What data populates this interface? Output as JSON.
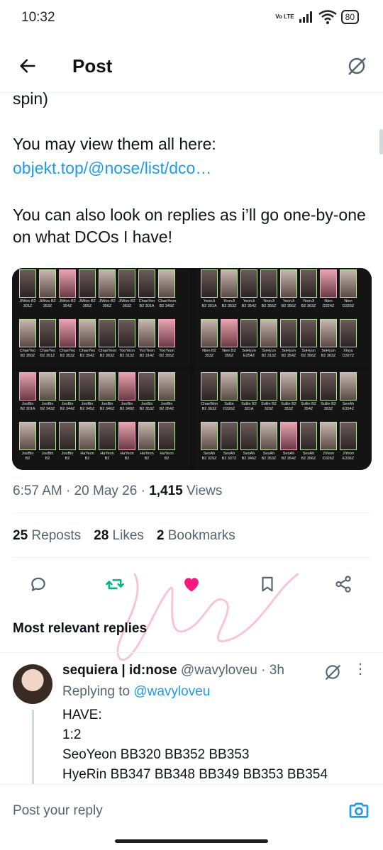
{
  "status_bar": {
    "time": "10:32",
    "network": "Vo LTE",
    "battery": "80"
  },
  "header": {
    "title": "Post"
  },
  "post": {
    "partial_text": "spin)",
    "view_text": "You may view them all here:",
    "link_text": "objekt.top/@nose/list/dco…",
    "replies_text": "You can also look on replies as i’ll go one-by-one on what DCOs I have!",
    "media_grid": [
      {
        "names": [
          "JiWoo",
          "JiWoo",
          "JiWoo",
          "JiWoo",
          "JiWoo",
          "JiWoo",
          "ChaeYeo",
          "ChaeYeon"
        ],
        "codes": [
          "B2 301Z",
          "B2 353Z",
          "B2 354Z",
          "B2 355Z",
          "B2 356Z",
          "B2 363Z",
          "B2 301A",
          "B2 349Z"
        ]
      },
      {
        "names": [
          "ChaeYeo",
          "ChaeYeo",
          "ChaeYeo",
          "ChaeYeo",
          "ChaeYeon",
          "YooYeon",
          "YooYeon",
          "YooYeon"
        ],
        "codes": [
          "B2 350Z",
          "B2 351Z",
          "B2 353Z",
          "B2 354Z",
          "B2 363Z",
          "B2 313Z",
          "B2 314Z",
          "B2 355Z"
        ]
      },
      {
        "names": [
          "YeonJi",
          "YeonJi",
          "YeonJi",
          "YeonJi",
          "YeonJi",
          "YeonJi",
          "Nien",
          "Nien"
        ],
        "codes": [
          "B2 301A",
          "B2 353Z",
          "B2 354Z",
          "B2 355Z",
          "B2 356Z",
          "B2 363Z",
          "D324Z",
          "D325Z"
        ]
      },
      {
        "names": [
          "Nien",
          "Nien",
          "SoHyun",
          "SoHyun",
          "SoHyun",
          "SoHyun",
          "SoHyun",
          "Xinyu"
        ],
        "codes": [
          "B2 353Z",
          "B2 356Z",
          "E354Z",
          "B2 313Z",
          "B2 354Z",
          "B2 356Z",
          "B2 363Z",
          "D327Z"
        ]
      },
      {
        "names": [
          "JooBin",
          "JooBin",
          "JooBin",
          "JooBin",
          "JooBin",
          "JooBin",
          "JooBin",
          "JooBin"
        ],
        "codes": [
          "B2 301A",
          "B2 343Z",
          "B2 344Z",
          "B2 345Z",
          "B2 346Z",
          "B2 349Z",
          "B2 353Z",
          "B2 354Z"
        ]
      },
      {
        "names": [
          "JooBin",
          "JooBin",
          "JooBin",
          "HaYeon",
          "HaYeon",
          "HaYeon",
          "HaYeon",
          "HaYeon"
        ],
        "codes": [
          "B2",
          "B2",
          "B2",
          "B2",
          "B2",
          "B2",
          "B2",
          "B2"
        ]
      },
      {
        "names": [
          "ChaeWon",
          "Sullin",
          "Sullin",
          "Sullin",
          "Sullin",
          "Sullin",
          "Sullin",
          "SeoAh"
        ],
        "codes": [
          "B2 363Z",
          "D326Z",
          "B2 301A",
          "B2 329Z",
          "B2 353Z",
          "B2 354Z",
          "B2 363Z",
          "E354Z"
        ]
      },
      {
        "names": [
          "SeoAh",
          "SeoAh",
          "SeoAh",
          "SeoAh",
          "SeoAh",
          "SeoAh",
          "JiYeon",
          "JiYeon"
        ],
        "codes": [
          "B2 329Z",
          "B2 337Z",
          "B2 346Z",
          "B2 353Z",
          "B2 354Z",
          "B2 356Z",
          "D326Z",
          "E336Z"
        ]
      }
    ],
    "timestamp": "6:57 AM · 20 May 26 · ",
    "views_count": "1,415",
    "views_label": " Views",
    "reposts_count": "25",
    "reposts_label": " Reposts",
    "likes_count": "28",
    "likes_label": " Likes",
    "bookmarks_count": "2",
    "bookmarks_label": " Bookmarks",
    "liked": true,
    "accent_color": "#1d9bf0",
    "like_color": "#f91880",
    "repost_color": "#00ba7c"
  },
  "replies_section": {
    "title": "Most relevant replies"
  },
  "reply": {
    "name": "sequiera | id:nose",
    "handle": "@wavyloveu",
    "time": "3h",
    "replying_prefix": "Replying to ",
    "replying_to": "@wavyloveu",
    "body_lines": [
      "HAVE:",
      "1:2",
      "SeoYeon BB320 BB352 BB353",
      "HyeRin BB347 BB348 BB349 BB353 BB354"
    ]
  },
  "composer": {
    "placeholder": "Post your reply"
  },
  "icons": {
    "back": "arrow-left-icon",
    "grok": "grok-icon",
    "reply": "reply-icon",
    "repost": "repost-icon",
    "like": "heart-icon",
    "bookmark": "bookmark-icon",
    "share": "share-icon",
    "camera": "camera-icon",
    "more": "more-icon"
  }
}
